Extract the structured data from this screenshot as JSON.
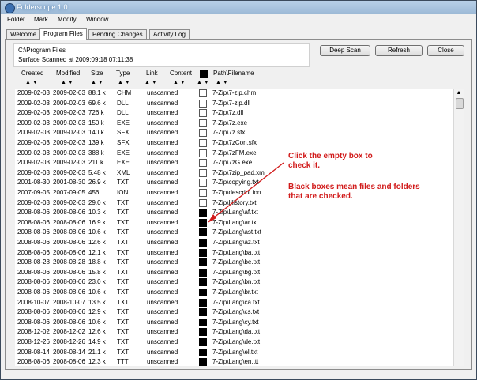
{
  "window": {
    "title": "Folderscope 1.0"
  },
  "menu": [
    "Folder",
    "Mark",
    "Modify",
    "Window"
  ],
  "tabs": [
    "Welcome",
    "Program Files",
    "Pending Changes",
    "Activity Log"
  ],
  "active_tab": 1,
  "info": {
    "path": "C:\\Program Files",
    "scanned": "Surface Scanned at 2009:09:18 07:11:38"
  },
  "buttons": {
    "deep_scan": "Deep Scan",
    "refresh": "Refresh",
    "close": "Close"
  },
  "columns": [
    "Created",
    "Modified",
    "Size",
    "Type",
    "Link",
    "Content",
    "Path\\Filename"
  ],
  "sort_arrows": "▲ ▼",
  "scroll_up_glyph": "▲",
  "rows": [
    {
      "created": "2009-02-03",
      "modified": "2009-02-03",
      "size": "88.1 k",
      "type": "CHM",
      "link": "unscanned",
      "checked": false,
      "path": "7-Zip\\7-zip.chm"
    },
    {
      "created": "2009-02-03",
      "modified": "2009-02-03",
      "size": "69.6 k",
      "type": "DLL",
      "link": "unscanned",
      "checked": false,
      "path": "7-Zip\\7-zip.dll"
    },
    {
      "created": "2009-02-03",
      "modified": "2009-02-03",
      "size": "726 k",
      "type": "DLL",
      "link": "unscanned",
      "checked": false,
      "path": "7-Zip\\7z.dll"
    },
    {
      "created": "2009-02-03",
      "modified": "2009-02-03",
      "size": "150 k",
      "type": "EXE",
      "link": "unscanned",
      "checked": false,
      "path": "7-Zip\\7z.exe"
    },
    {
      "created": "2009-02-03",
      "modified": "2009-02-03",
      "size": "140 k",
      "type": "SFX",
      "link": "unscanned",
      "checked": false,
      "path": "7-Zip\\7z.sfx"
    },
    {
      "created": "2009-02-03",
      "modified": "2009-02-03",
      "size": "139 k",
      "type": "SFX",
      "link": "unscanned",
      "checked": false,
      "path": "7-Zip\\7zCon.sfx"
    },
    {
      "created": "2009-02-03",
      "modified": "2009-02-03",
      "size": "388 k",
      "type": "EXE",
      "link": "unscanned",
      "checked": false,
      "path": "7-Zip\\7zFM.exe"
    },
    {
      "created": "2009-02-03",
      "modified": "2009-02-03",
      "size": "211 k",
      "type": "EXE",
      "link": "unscanned",
      "checked": false,
      "path": "7-Zip\\7zG.exe"
    },
    {
      "created": "2009-02-03",
      "modified": "2009-02-03",
      "size": "5.48 k",
      "type": "XML",
      "link": "unscanned",
      "checked": false,
      "path": "7-Zip\\7zip_pad.xml"
    },
    {
      "created": "2001-08-30",
      "modified": "2001-08-30",
      "size": "26.9 k",
      "type": "TXT",
      "link": "unscanned",
      "checked": false,
      "path": "7-Zip\\copying.txt"
    },
    {
      "created": "2007-09-05",
      "modified": "2007-09-05",
      "size": "456",
      "type": "ION",
      "link": "unscanned",
      "checked": false,
      "path": "7-Zip\\descript.ion"
    },
    {
      "created": "2009-02-03",
      "modified": "2009-02-03",
      "size": "29.0 k",
      "type": "TXT",
      "link": "unscanned",
      "checked": false,
      "path": "7-Zip\\History.txt"
    },
    {
      "created": "2008-08-06",
      "modified": "2008-08-06",
      "size": "10.3 k",
      "type": "TXT",
      "link": "unscanned",
      "checked": true,
      "path": "7-Zip\\Lang\\af.txt"
    },
    {
      "created": "2008-08-06",
      "modified": "2008-08-06",
      "size": "16.9 k",
      "type": "TXT",
      "link": "unscanned",
      "checked": true,
      "path": "7-Zip\\Lang\\ar.txt"
    },
    {
      "created": "2008-08-06",
      "modified": "2008-08-06",
      "size": "10.6 k",
      "type": "TXT",
      "link": "unscanned",
      "checked": true,
      "path": "7-Zip\\Lang\\ast.txt"
    },
    {
      "created": "2008-08-06",
      "modified": "2008-08-06",
      "size": "12.6 k",
      "type": "TXT",
      "link": "unscanned",
      "checked": true,
      "path": "7-Zip\\Lang\\az.txt"
    },
    {
      "created": "2008-08-06",
      "modified": "2008-08-06",
      "size": "12.1 k",
      "type": "TXT",
      "link": "unscanned",
      "checked": true,
      "path": "7-Zip\\Lang\\ba.txt"
    },
    {
      "created": "2008-08-28",
      "modified": "2008-08-28",
      "size": "18.8 k",
      "type": "TXT",
      "link": "unscanned",
      "checked": true,
      "path": "7-Zip\\Lang\\be.txt"
    },
    {
      "created": "2008-08-06",
      "modified": "2008-08-06",
      "size": "15.8 k",
      "type": "TXT",
      "link": "unscanned",
      "checked": true,
      "path": "7-Zip\\Lang\\bg.txt"
    },
    {
      "created": "2008-08-06",
      "modified": "2008-08-06",
      "size": "23.0 k",
      "type": "TXT",
      "link": "unscanned",
      "checked": true,
      "path": "7-Zip\\Lang\\bn.txt"
    },
    {
      "created": "2008-08-06",
      "modified": "2008-08-06",
      "size": "10.6 k",
      "type": "TXT",
      "link": "unscanned",
      "checked": true,
      "path": "7-Zip\\Lang\\br.txt"
    },
    {
      "created": "2008-10-07",
      "modified": "2008-10-07",
      "size": "13.5 k",
      "type": "TXT",
      "link": "unscanned",
      "checked": true,
      "path": "7-Zip\\Lang\\ca.txt"
    },
    {
      "created": "2008-08-06",
      "modified": "2008-08-06",
      "size": "12.9 k",
      "type": "TXT",
      "link": "unscanned",
      "checked": true,
      "path": "7-Zip\\Lang\\cs.txt"
    },
    {
      "created": "2008-08-06",
      "modified": "2008-08-06",
      "size": "10.6 k",
      "type": "TXT",
      "link": "unscanned",
      "checked": true,
      "path": "7-Zip\\Lang\\cy.txt"
    },
    {
      "created": "2008-12-02",
      "modified": "2008-12-02",
      "size": "12.6 k",
      "type": "TXT",
      "link": "unscanned",
      "checked": true,
      "path": "7-Zip\\Lang\\da.txt"
    },
    {
      "created": "2008-12-26",
      "modified": "2008-12-26",
      "size": "14.9 k",
      "type": "TXT",
      "link": "unscanned",
      "checked": true,
      "path": "7-Zip\\Lang\\de.txt"
    },
    {
      "created": "2008-08-14",
      "modified": "2008-08-14",
      "size": "21.1 k",
      "type": "TXT",
      "link": "unscanned",
      "checked": true,
      "path": "7-Zip\\Lang\\el.txt"
    },
    {
      "created": "2008-08-06",
      "modified": "2008-08-06",
      "size": "12.3 k",
      "type": "TTT",
      "link": "unscanned",
      "checked": true,
      "path": "7-Zip\\Lang\\en.ttt"
    }
  ],
  "annotation": {
    "line1": [
      "Click the empty box to",
      "check it."
    ],
    "line2": [
      "Black boxes mean files and folders",
      "that are checked."
    ],
    "color": "#d11a1a"
  }
}
